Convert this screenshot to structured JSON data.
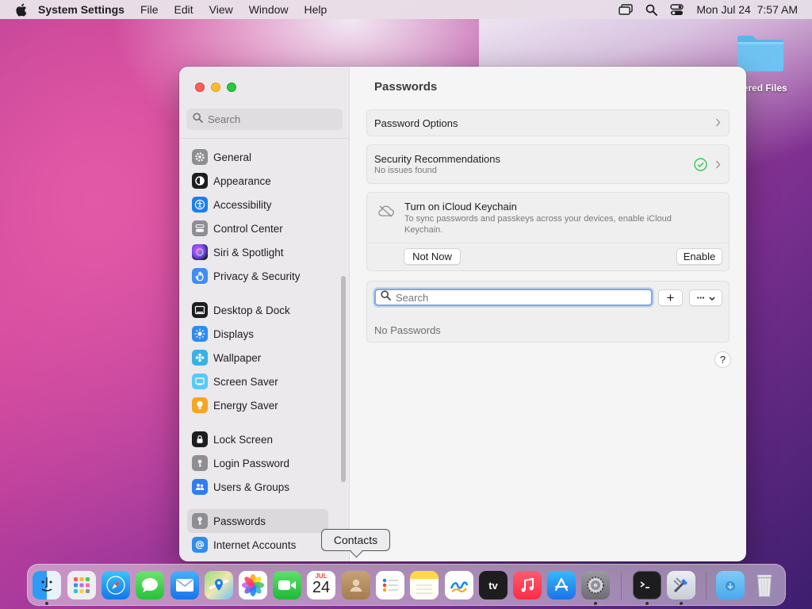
{
  "menubar": {
    "app_name": "System Settings",
    "items": [
      "File",
      "Edit",
      "View",
      "Window",
      "Help"
    ],
    "datetime": "Mon Jul 24  7:57 AM"
  },
  "desktop": {
    "folder_label": "vered Files"
  },
  "sidebar": {
    "search_placeholder": "Search",
    "items": [
      {
        "label": "General",
        "color": "#8e8e93"
      },
      {
        "label": "Appearance",
        "color": "#1d1d1f"
      },
      {
        "label": "Accessibility",
        "color": "#1a7ef0"
      },
      {
        "label": "Control Center",
        "color": "#8e8e93"
      },
      {
        "label": "Siri & Spotlight",
        "color": "#b44fd3"
      },
      {
        "label": "Privacy & Security",
        "color": "#3f8cf5"
      },
      {
        "label": "Desktop & Dock",
        "color": "#1d1d1f"
      },
      {
        "label": "Displays",
        "color": "#2f8bf0"
      },
      {
        "label": "Wallpaper",
        "color": "#37b2e8"
      },
      {
        "label": "Screen Saver",
        "color": "#5ac8fa"
      },
      {
        "label": "Energy Saver",
        "color": "#f5a623"
      },
      {
        "label": "Lock Screen",
        "color": "#1d1d1f"
      },
      {
        "label": "Login Password",
        "color": "#8e8e93"
      },
      {
        "label": "Users & Groups",
        "color": "#2f7df0"
      },
      {
        "label": "Passwords",
        "color": "#8e8e93"
      },
      {
        "label": "Internet Accounts",
        "color": "#2f8bf0"
      }
    ]
  },
  "main": {
    "title": "Passwords",
    "password_options": "Password Options",
    "security_title": "Security Recommendations",
    "security_sub": "No issues found",
    "keychain_title": "Turn on iCloud Keychain",
    "keychain_desc": "To sync passwords and passkeys across your devices, enable iCloud Keychain.",
    "not_now": "Not Now",
    "enable": "Enable",
    "search_placeholder": "Search",
    "add": "+",
    "more": "···",
    "empty": "No Passwords",
    "help": "?"
  },
  "dock": {
    "tooltip": "Contacts",
    "calendar_month": "JUL",
    "calendar_day": "24",
    "tv_label": "tv",
    "apps": [
      "finder",
      "launchpad",
      "safari",
      "messages",
      "mail",
      "maps",
      "photos",
      "facetime",
      "calendar",
      "contacts",
      "reminders",
      "notes",
      "freeform",
      "tv",
      "music",
      "app-store",
      "system-settings",
      "terminal",
      "script-editor",
      "downloads",
      "trash"
    ]
  }
}
